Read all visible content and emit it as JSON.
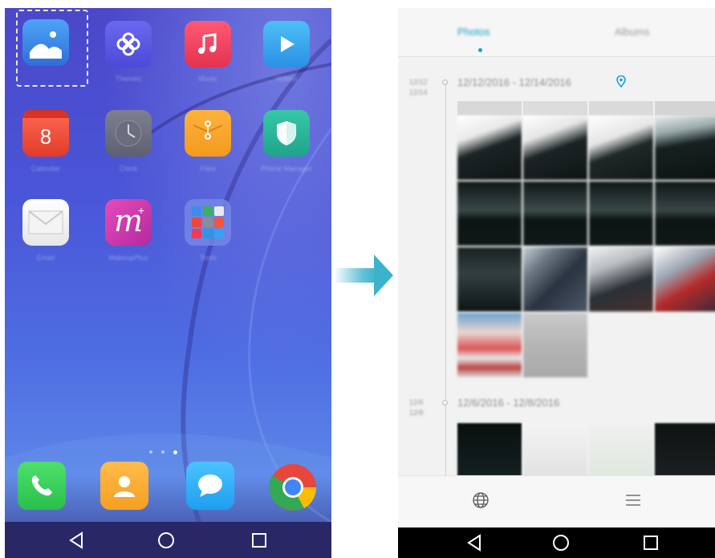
{
  "home": {
    "apps": [
      {
        "name": "gallery-app",
        "label": "Gallery",
        "color": "#3a7fe0"
      },
      {
        "name": "themes-app",
        "label": "Themes",
        "color": "#5e5ce6"
      },
      {
        "name": "music-app",
        "label": "Music",
        "color": "#f23f5e"
      },
      {
        "name": "videos-app",
        "label": "Videos",
        "color": "#3aa8ef"
      },
      {
        "name": "calendar-app",
        "label": "Calendar",
        "color": "#e84d3c",
        "text": "8"
      },
      {
        "name": "clock-app",
        "label": "Clock",
        "color": "#6f7283"
      },
      {
        "name": "files-app",
        "label": "Files",
        "color": "#f5a623"
      },
      {
        "name": "phone-manager-app",
        "label": "Phone Manager",
        "color": "#2bb59b"
      },
      {
        "name": "email-app",
        "label": "Email",
        "color": "#f0f0f0"
      },
      {
        "name": "makeupplus-app",
        "label": "MakeupPlus",
        "color": "#d63aa5"
      },
      {
        "name": "tools-folder",
        "label": "Tools",
        "color": "#6b7bd8"
      }
    ],
    "dock": [
      "phone",
      "contacts",
      "messages",
      "chrome"
    ],
    "page_count": 3,
    "active_page": 3
  },
  "gallery": {
    "tabs": {
      "photos": "Photos",
      "albums": "Albums"
    },
    "groups": [
      {
        "date_range": "12/12/2016 - 12/14/2016",
        "side_dates": "12/12\n12/14",
        "has_location": true
      },
      {
        "date_range": "12/6/2016 - 12/8/2016",
        "side_dates": "12/6\n12/8",
        "has_location": false
      }
    ]
  },
  "colors": {
    "accent": "#18a2c7",
    "arrow": "#3db2cc"
  }
}
